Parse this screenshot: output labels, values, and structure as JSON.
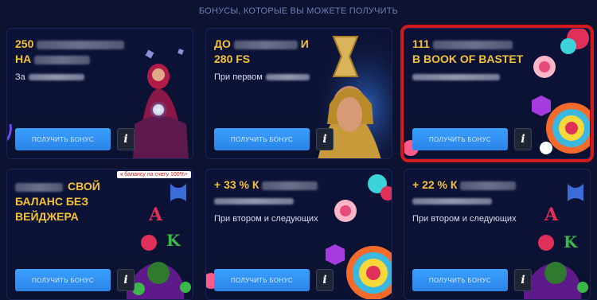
{
  "header": {
    "text": "БОНУСЫ, КОТОРЫЕ ВЫ МОЖЕТЕ ПОЛУЧИТЬ"
  },
  "cards": [
    {
      "title_line1": "250",
      "title_line2": "НА",
      "desc": "За",
      "button": "ПОЛУЧИТЬ БОНУС",
      "info": "i"
    },
    {
      "title_line1": "ДО",
      "title_line1b": "И",
      "title_line2": "280 FS",
      "desc": "При первом",
      "button": "ПОЛУЧИТЬ БОНУС",
      "info": "i"
    },
    {
      "title_line1": "111",
      "title_line2": "В BOOK OF BASTET",
      "button": "ПОЛУЧИТЬ БОНУС",
      "info": "i",
      "selected": true
    },
    {
      "title_line1": "СВОЙ",
      "title_line2": "БАЛАНС БЕЗ",
      "title_line3": "ВЕЙДЖЕРА",
      "tooltip": "к балансу на счету 100%+",
      "button": "ПОЛУЧИТЬ БОНУС",
      "info": "i"
    },
    {
      "title_line1": "+ 33 % К",
      "desc": "При втором и следующих",
      "button": "ПОЛУЧИТЬ БОНУС",
      "info": "i"
    },
    {
      "title_line1": "+ 22 % К",
      "desc": "При втором и следующих",
      "button": "ПОЛУЧИТЬ БОНУС",
      "info": "i"
    }
  ],
  "colors": {
    "accent": "#f3c13a",
    "button": "#2b84e8",
    "selection": "#d11a1a",
    "background": "#0c1230"
  }
}
